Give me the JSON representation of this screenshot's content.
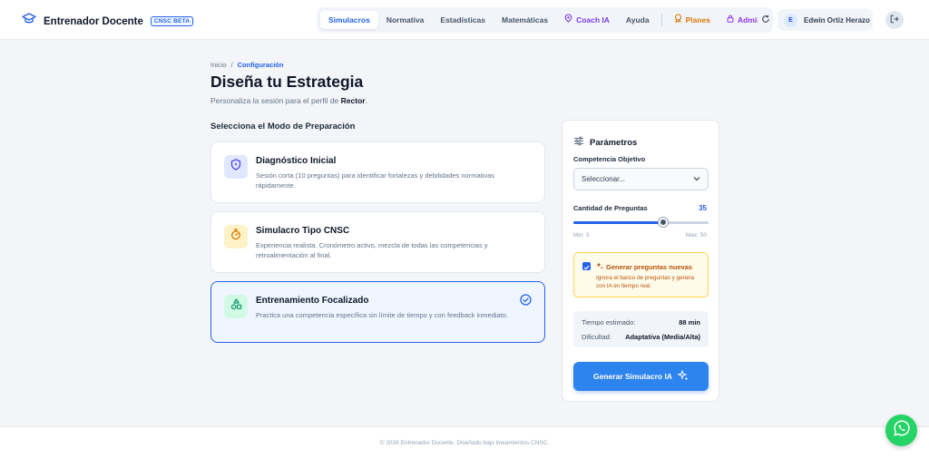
{
  "brand": {
    "title": "Entrenador Docente",
    "badge": "CNSC BETA"
  },
  "nav": {
    "items": [
      {
        "label": "Simulacros",
        "active": true
      },
      {
        "label": "Normativa"
      },
      {
        "label": "Estadísticas"
      },
      {
        "label": "Matemáticas"
      },
      {
        "label": "Coach IA",
        "icon": "sparkle-icon"
      },
      {
        "label": "Ayuda"
      }
    ],
    "planes": "Planes",
    "admin": "Admin"
  },
  "user": {
    "initial": "E",
    "name": "Edwin Ortiz Herazo"
  },
  "breadcrumb": {
    "home": "Inicio",
    "separator": "/",
    "current": "Configuración"
  },
  "page": {
    "title": "Diseña tu Estrategia",
    "subtitle_prefix": "Personaliza la sesión para el perfil de ",
    "profile": "Rector",
    "subtitle_suffix": "."
  },
  "modes": {
    "heading": "Selecciona el Modo de Preparación",
    "items": [
      {
        "title": "Diagnóstico Inicial",
        "desc": "Sesión corta (10 preguntas) para identificar fortalezas y debilidades normativas rápidamente.",
        "icon": "shield-icon",
        "color": "#4f46e5",
        "bg": "#e0e7ff"
      },
      {
        "title": "Simulacro Tipo CNSC",
        "desc": "Experiencia realista. Cronómetro activo, mezcla de todas las competencias y retroalimentación al final.",
        "icon": "stopwatch-icon",
        "color": "#d97706",
        "bg": "#fef3c7"
      },
      {
        "title": "Entrenamiento Focalizado",
        "desc": "Practica una competencia específica sin límite de tiempo y con feedback inmediato.",
        "icon": "shapes-icon",
        "color": "#059669",
        "bg": "#d1fae5",
        "selected": true
      }
    ]
  },
  "params": {
    "title": "Parámetros",
    "competencia_label": "Competencia Objetivo",
    "competencia_value": "Seleccionar...",
    "cantidad_label": "Cantidad de Preguntas",
    "cantidad_value": "35",
    "cantidad_min": 5,
    "cantidad_max": 50,
    "min_label": "Min: 5",
    "max_label": "Max: 50",
    "generar": {
      "checked": true,
      "title": "Generar preguntas nuevas",
      "desc": "Ignora el banco de preguntas y genera con IA en tiempo real."
    },
    "tiempo_label": "Tiempo estimado:",
    "tiempo_value": "88 min",
    "dificultad_label": "Dificultad:",
    "dificultad_value": "Adaptativa (Media/Alta)",
    "button": "Generar Simulacro IA"
  },
  "footer": "© 2026 Entrenador Docente. Diseñado bajo lineamientos CNSC.",
  "colors": {
    "primary": "#2563eb",
    "amber": "#d97706",
    "whatsapp": "#25d366"
  }
}
